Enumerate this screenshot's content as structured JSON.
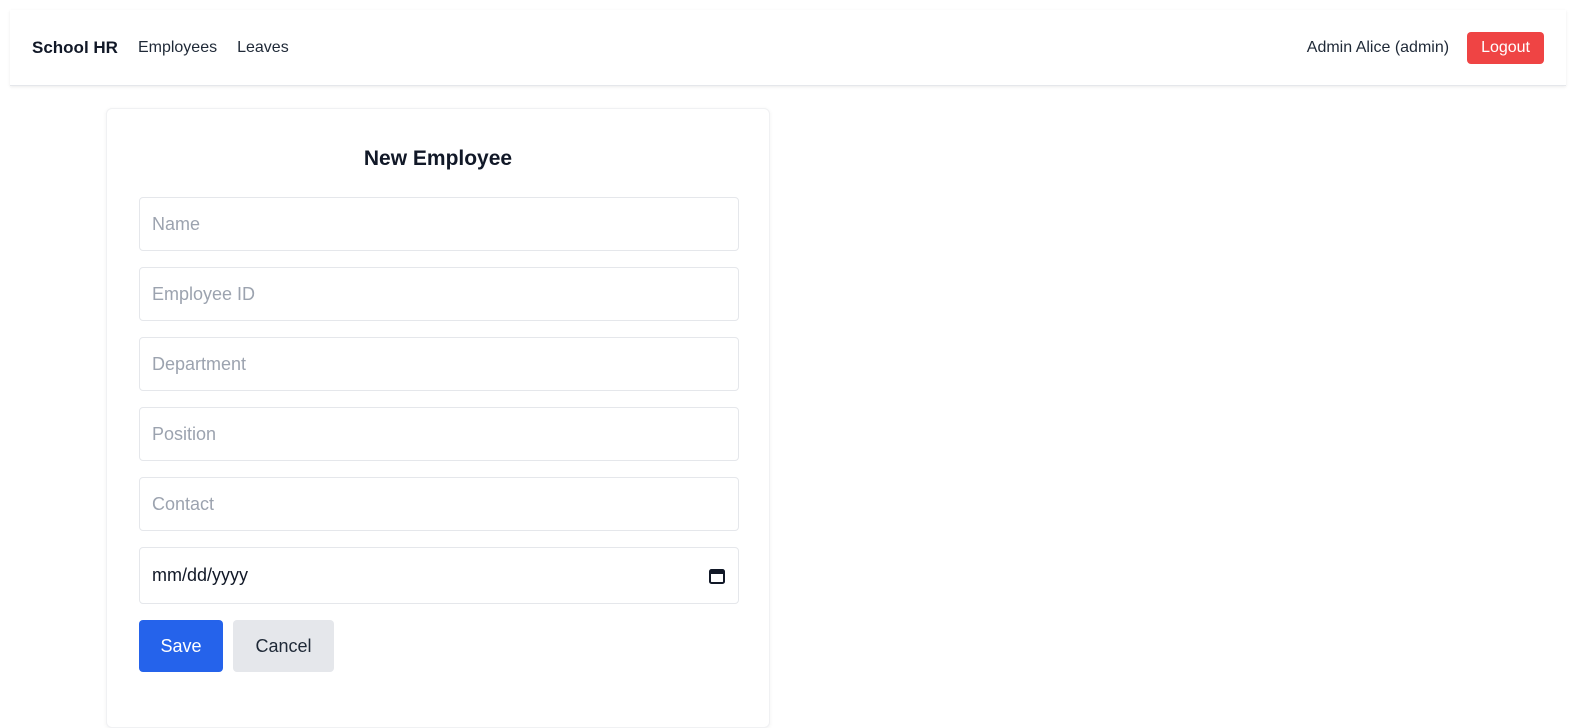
{
  "navbar": {
    "brand": "School HR",
    "links": [
      {
        "label": "Employees"
      },
      {
        "label": "Leaves"
      }
    ],
    "user_label": "Admin Alice (admin)",
    "logout_label": "Logout"
  },
  "form": {
    "title": "New Employee",
    "fields": {
      "name": {
        "placeholder": "Name",
        "value": ""
      },
      "employee_id": {
        "placeholder": "Employee ID",
        "value": ""
      },
      "department": {
        "placeholder": "Department",
        "value": ""
      },
      "position": {
        "placeholder": "Position",
        "value": ""
      },
      "contact": {
        "placeholder": "Contact",
        "value": ""
      }
    },
    "date": {
      "display": "mm/dd/yyyy"
    },
    "save_label": "Save",
    "cancel_label": "Cancel"
  },
  "colors": {
    "logout": "#ef4444",
    "primary": "#2563eb",
    "secondary": "#e5e7eb"
  },
  "icons": {
    "date_picker": "calendar-icon"
  }
}
